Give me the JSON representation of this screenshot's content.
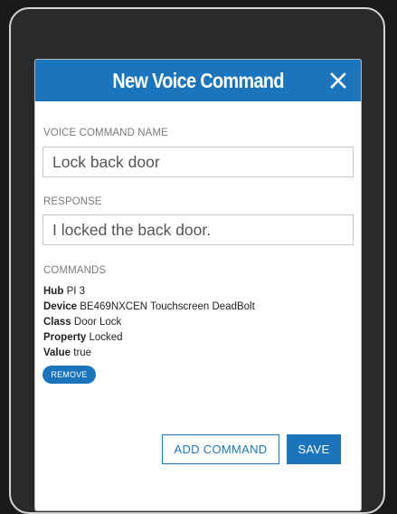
{
  "dialog": {
    "title": "New Voice Command",
    "close_icon": "close-icon"
  },
  "fields": {
    "name_label": "VOICE COMMAND NAME",
    "name_value": "Lock back door",
    "response_label": "RESPONSE",
    "response_value": "I locked the back door."
  },
  "commands": {
    "label": "COMMANDS",
    "items": [
      {
        "key": "Hub",
        "value": "PI 3"
      },
      {
        "key": "Device",
        "value": "BE469NXCEN Touchscreen DeadBolt"
      },
      {
        "key": "Class",
        "value": "Door Lock"
      },
      {
        "key": "Property",
        "value": "Locked"
      },
      {
        "key": "Value",
        "value": "true"
      }
    ],
    "remove_label": "REMOVE"
  },
  "actions": {
    "add_label": "ADD COMMAND",
    "save_label": "SAVE"
  },
  "colors": {
    "accent": "#1a75bc",
    "background": "#1a1a1a"
  }
}
